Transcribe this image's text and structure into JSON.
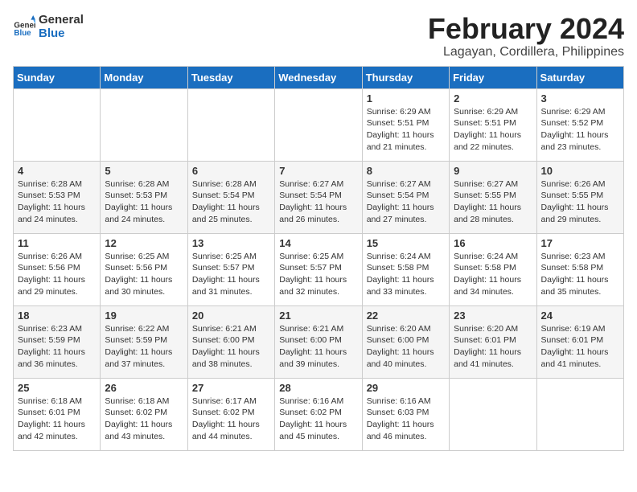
{
  "logo": {
    "text_general": "General",
    "text_blue": "Blue"
  },
  "header": {
    "title": "February 2024",
    "subtitle": "Lagayan, Cordillera, Philippines"
  },
  "weekdays": [
    "Sunday",
    "Monday",
    "Tuesday",
    "Wednesday",
    "Thursday",
    "Friday",
    "Saturday"
  ],
  "weeks": [
    [
      {
        "day": "",
        "info": ""
      },
      {
        "day": "",
        "info": ""
      },
      {
        "day": "",
        "info": ""
      },
      {
        "day": "",
        "info": ""
      },
      {
        "day": "1",
        "info": "Sunrise: 6:29 AM\nSunset: 5:51 PM\nDaylight: 11 hours\nand 21 minutes."
      },
      {
        "day": "2",
        "info": "Sunrise: 6:29 AM\nSunset: 5:51 PM\nDaylight: 11 hours\nand 22 minutes."
      },
      {
        "day": "3",
        "info": "Sunrise: 6:29 AM\nSunset: 5:52 PM\nDaylight: 11 hours\nand 23 minutes."
      }
    ],
    [
      {
        "day": "4",
        "info": "Sunrise: 6:28 AM\nSunset: 5:53 PM\nDaylight: 11 hours\nand 24 minutes."
      },
      {
        "day": "5",
        "info": "Sunrise: 6:28 AM\nSunset: 5:53 PM\nDaylight: 11 hours\nand 24 minutes."
      },
      {
        "day": "6",
        "info": "Sunrise: 6:28 AM\nSunset: 5:54 PM\nDaylight: 11 hours\nand 25 minutes."
      },
      {
        "day": "7",
        "info": "Sunrise: 6:27 AM\nSunset: 5:54 PM\nDaylight: 11 hours\nand 26 minutes."
      },
      {
        "day": "8",
        "info": "Sunrise: 6:27 AM\nSunset: 5:54 PM\nDaylight: 11 hours\nand 27 minutes."
      },
      {
        "day": "9",
        "info": "Sunrise: 6:27 AM\nSunset: 5:55 PM\nDaylight: 11 hours\nand 28 minutes."
      },
      {
        "day": "10",
        "info": "Sunrise: 6:26 AM\nSunset: 5:55 PM\nDaylight: 11 hours\nand 29 minutes."
      }
    ],
    [
      {
        "day": "11",
        "info": "Sunrise: 6:26 AM\nSunset: 5:56 PM\nDaylight: 11 hours\nand 29 minutes."
      },
      {
        "day": "12",
        "info": "Sunrise: 6:25 AM\nSunset: 5:56 PM\nDaylight: 11 hours\nand 30 minutes."
      },
      {
        "day": "13",
        "info": "Sunrise: 6:25 AM\nSunset: 5:57 PM\nDaylight: 11 hours\nand 31 minutes."
      },
      {
        "day": "14",
        "info": "Sunrise: 6:25 AM\nSunset: 5:57 PM\nDaylight: 11 hours\nand 32 minutes."
      },
      {
        "day": "15",
        "info": "Sunrise: 6:24 AM\nSunset: 5:58 PM\nDaylight: 11 hours\nand 33 minutes."
      },
      {
        "day": "16",
        "info": "Sunrise: 6:24 AM\nSunset: 5:58 PM\nDaylight: 11 hours\nand 34 minutes."
      },
      {
        "day": "17",
        "info": "Sunrise: 6:23 AM\nSunset: 5:58 PM\nDaylight: 11 hours\nand 35 minutes."
      }
    ],
    [
      {
        "day": "18",
        "info": "Sunrise: 6:23 AM\nSunset: 5:59 PM\nDaylight: 11 hours\nand 36 minutes."
      },
      {
        "day": "19",
        "info": "Sunrise: 6:22 AM\nSunset: 5:59 PM\nDaylight: 11 hours\nand 37 minutes."
      },
      {
        "day": "20",
        "info": "Sunrise: 6:21 AM\nSunset: 6:00 PM\nDaylight: 11 hours\nand 38 minutes."
      },
      {
        "day": "21",
        "info": "Sunrise: 6:21 AM\nSunset: 6:00 PM\nDaylight: 11 hours\nand 39 minutes."
      },
      {
        "day": "22",
        "info": "Sunrise: 6:20 AM\nSunset: 6:00 PM\nDaylight: 11 hours\nand 40 minutes."
      },
      {
        "day": "23",
        "info": "Sunrise: 6:20 AM\nSunset: 6:01 PM\nDaylight: 11 hours\nand 41 minutes."
      },
      {
        "day": "24",
        "info": "Sunrise: 6:19 AM\nSunset: 6:01 PM\nDaylight: 11 hours\nand 41 minutes."
      }
    ],
    [
      {
        "day": "25",
        "info": "Sunrise: 6:18 AM\nSunset: 6:01 PM\nDaylight: 11 hours\nand 42 minutes."
      },
      {
        "day": "26",
        "info": "Sunrise: 6:18 AM\nSunset: 6:02 PM\nDaylight: 11 hours\nand 43 minutes."
      },
      {
        "day": "27",
        "info": "Sunrise: 6:17 AM\nSunset: 6:02 PM\nDaylight: 11 hours\nand 44 minutes."
      },
      {
        "day": "28",
        "info": "Sunrise: 6:16 AM\nSunset: 6:02 PM\nDaylight: 11 hours\nand 45 minutes."
      },
      {
        "day": "29",
        "info": "Sunrise: 6:16 AM\nSunset: 6:03 PM\nDaylight: 11 hours\nand 46 minutes."
      },
      {
        "day": "",
        "info": ""
      },
      {
        "day": "",
        "info": ""
      }
    ]
  ]
}
